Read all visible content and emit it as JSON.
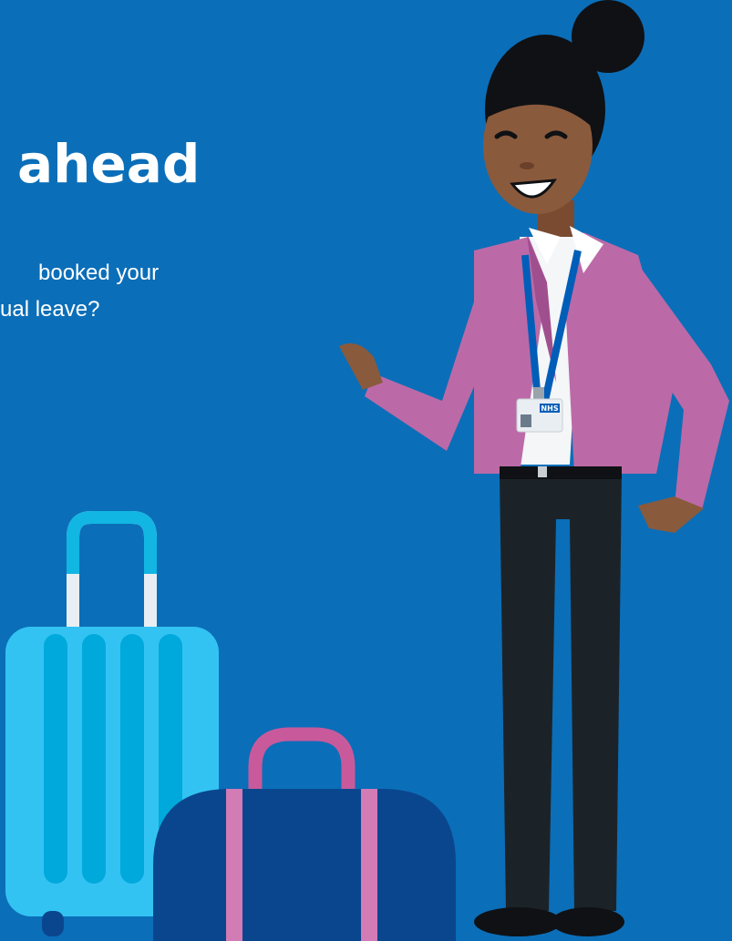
{
  "heading": "ahead",
  "subtext": {
    "line1": "booked your",
    "line2": "ual leave?"
  },
  "badge": {
    "logo": "NHS"
  },
  "colors": {
    "background": "#0b6eb8",
    "suitcase": "#33c3f3",
    "suitcase_stripe": "#00a9dc",
    "bag": "#0a468e",
    "bag_accent": "#d27bb4",
    "jacket": "#bb6aa7",
    "trousers": "#1c2328",
    "skin": "#8a5a3c"
  }
}
